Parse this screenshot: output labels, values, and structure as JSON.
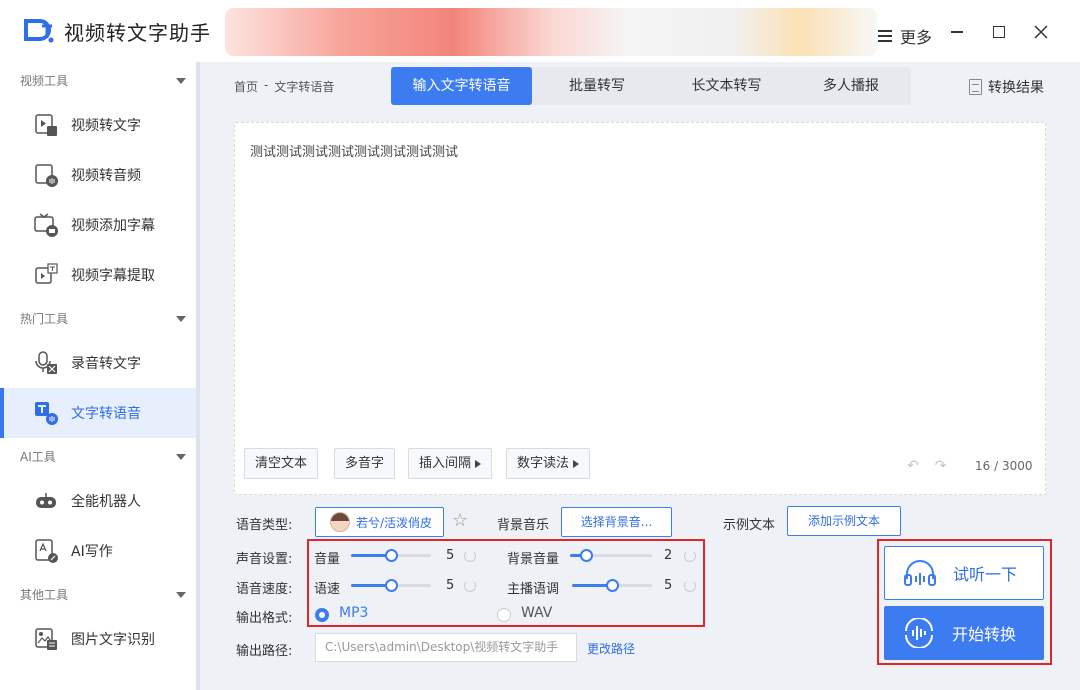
{
  "app": {
    "title": "视频转文字助手",
    "more_label": "更多"
  },
  "sidebar": {
    "sections": [
      {
        "title": "视频工具",
        "items": [
          "视频转文字",
          "视频转音频",
          "视频添加字幕",
          "视频字幕提取"
        ]
      },
      {
        "title": "热门工具",
        "items": [
          "录音转文字",
          "文字转语音"
        ]
      },
      {
        "title": "AI工具",
        "items": [
          "全能机器人",
          "AI写作"
        ]
      },
      {
        "title": "其他工具",
        "items": [
          "图片文字识别"
        ]
      }
    ],
    "active_item": "文字转语音"
  },
  "breadcrumb": {
    "home": "首页",
    "separator": "-",
    "current": "文字转语音"
  },
  "tabs": [
    "输入文字转语音",
    "批量转写",
    "长文本转写",
    "多人播报"
  ],
  "active_tab": "输入文字转语音",
  "result_link": "转换结果",
  "editor": {
    "text": "测试测试测试测试测试测试测试测试",
    "buttons": {
      "clear": "清空文本",
      "polyphone": "多音字",
      "insert_pause": "插入间隔",
      "number_reading": "数字读法"
    },
    "char_count": "16 / 3000"
  },
  "voice": {
    "type_label": "语音类型:",
    "voice_name": "若兮/活泼俏皮",
    "bgm_label": "背景音乐",
    "bgm_button": "选择背景音...",
    "sample_label": "示例文本",
    "sample_button": "添加示例文本"
  },
  "settings": {
    "sound_label": "声音设置:",
    "speed_row_label": "语音速度:",
    "format_label": "输出格式:",
    "volume": {
      "label": "音量",
      "value": 5,
      "max": 10
    },
    "bg_volume": {
      "label": "背景音量",
      "value": 2,
      "max": 10
    },
    "speed": {
      "label": "语速",
      "value": 5,
      "max": 10
    },
    "pitch": {
      "label": "主播语调",
      "value": 5,
      "max": 10
    },
    "formats": [
      "MP3",
      "WAV"
    ],
    "selected_format": "MP3"
  },
  "output": {
    "path_label": "输出路径:",
    "path": "C:\\Users\\admin\\Desktop\\视频转文字助手",
    "change_path": "更改路径"
  },
  "actions": {
    "listen": "试听一下",
    "start": "开始转换"
  },
  "colors": {
    "accent": "#3d7bf0",
    "highlight_border": "#e0262a"
  }
}
